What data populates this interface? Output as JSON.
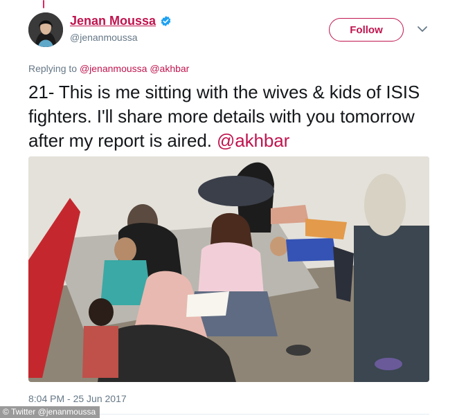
{
  "tweet": {
    "display_name": "Jenan Moussa",
    "handle": "@jenanmoussa",
    "follow_label": "Follow",
    "replying_prefix": "Replying to",
    "replying_to": [
      "@jenanmoussa",
      "@akhbar"
    ],
    "text": "21- This is me sitting with the wives & kids of ISIS fighters. I'll share more details with you tomorrow after my report is aired.",
    "text_mention": "@akhbar",
    "timestamp": "8:04 PM - 25 Jun 2017",
    "verified_icon": "verified-badge-icon",
    "menu_icon": "chevron-down-icon"
  },
  "credit": "© Twitter @jenanmoussa",
  "colors": {
    "accent": "#c0144f",
    "muted": "#657786",
    "verified": "#1da1f2",
    "text": "#14171a"
  }
}
